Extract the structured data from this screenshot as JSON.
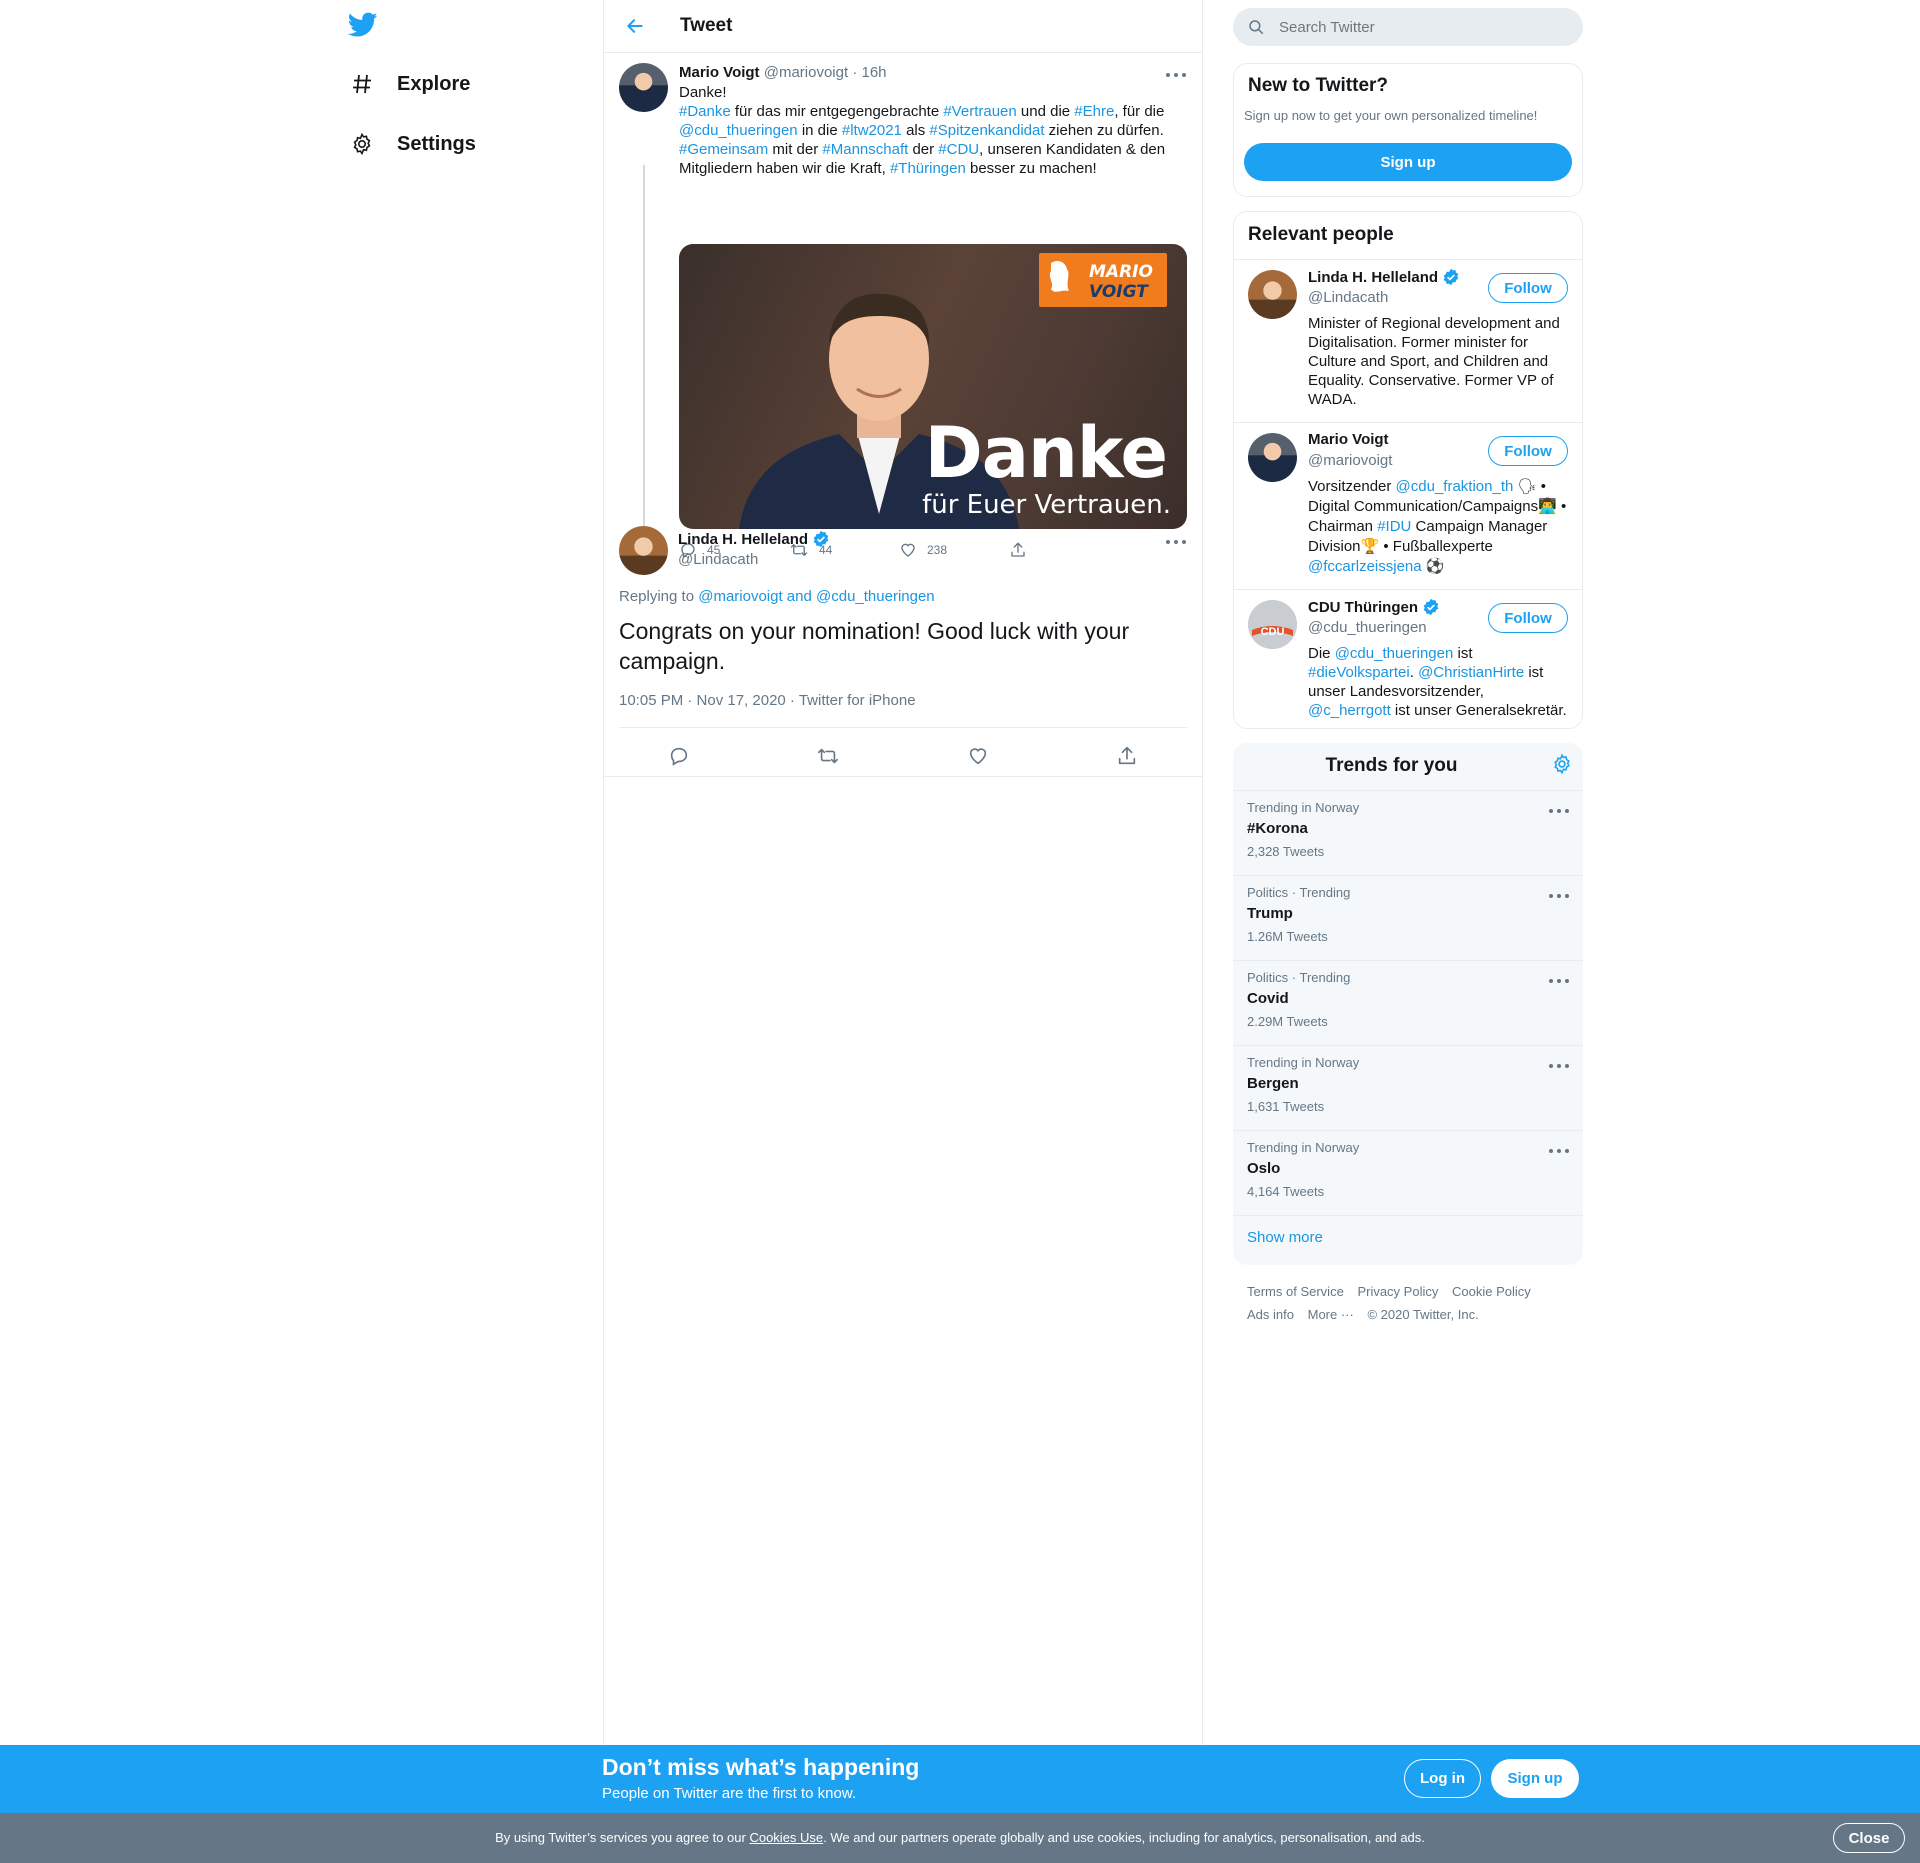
{
  "nav": {
    "logo": "twitter-bird-icon",
    "items": [
      {
        "label": "Explore",
        "icon": "hashtag-icon"
      },
      {
        "label": "Settings",
        "icon": "gear-icon"
      }
    ]
  },
  "header": {
    "title": "Tweet",
    "back_icon": "arrow-left-icon"
  },
  "parent_tweet": {
    "name": "Mario Voigt",
    "handle": "@mariovoigt",
    "time": "· 16h",
    "line1": "Danke!",
    "seg": [
      "#Danke",
      " für das mir entgegengebrachte ",
      "#Vertrauen",
      " und die ",
      "#Ehre",
      ", für die ",
      "@cdu_thueringen",
      " in die ",
      "#ltw2021",
      " als ",
      "#Spitzenkandidat",
      " ziehen zu dürfen.",
      "#Gemeinsam",
      " mit der ",
      "#Mannschaft",
      " der ",
      "#CDU",
      ", unseren Kandidaten & den Mitgliedern haben wir die Kraft, ",
      "#Thüringen",
      " besser zu machen!"
    ],
    "media": {
      "headline": "Danke",
      "subline": "für Euer Vertrauen.",
      "brand_top": "MARIO",
      "brand_bottom": "VOIGT"
    },
    "replies": "45",
    "retweets": "44",
    "likes": "238"
  },
  "main_tweet": {
    "name": "Linda H. Helleland",
    "handle": "@Lindacath",
    "replying_prefix": "Replying to",
    "replying_to": "@mariovoigt and @cdu_thueringen",
    "text": "Congrats on your nomination! Good luck with your campaign.",
    "meta": "10:05 PM · Nov 17, 2020 · Twitter for iPhone"
  },
  "search": {
    "placeholder": "Search Twitter"
  },
  "new_to_twitter": {
    "title": "New to Twitter?",
    "subtitle": "Sign up now to get your own personalized timeline!",
    "button": "Sign up"
  },
  "relevant": {
    "title": "Relevant people",
    "follow_label": "Follow",
    "people": [
      {
        "name": "Linda H. Helleland",
        "handle": "@Lindacath",
        "bio": "Minister of Regional development and Digitalisation. Former minister for Culture and Sport, and Children and Equality. Conservative. Former VP of WADA."
      },
      {
        "name": "Mario Voigt",
        "handle": "@mariovoigt",
        "bio_seg": [
          "Vorsitzender ",
          "@cdu_fraktion_th",
          " 🗣 • Digital Communication/Campaigns👨‍💻 • Chairman ",
          "#IDU",
          " Campaign Manager Division🏆 • Fußballexperte ",
          "@fccarlzeissjena",
          " ⚽"
        ]
      },
      {
        "name": "CDU Thüringen",
        "handle": "@cdu_thueringen",
        "avatar_text": "CDU",
        "bio_seg": [
          "Die ",
          "@cdu_thueringen",
          " ist ",
          "#dieVolkspartei",
          ". ",
          "@ChristianHirte",
          " ist unser Landesvorsitzender, ",
          "@c_herrgott",
          " ist unser Generalsekretär."
        ]
      }
    ]
  },
  "trends": {
    "title": "Trends for you",
    "items": [
      {
        "context": "Trending in Norway",
        "name": "#Korona",
        "count": "2,328 Tweets"
      },
      {
        "context": "Politics · Trending",
        "name": "Trump",
        "count": "1.26M Tweets"
      },
      {
        "context": "Politics · Trending",
        "name": "Covid",
        "count": "2.29M Tweets"
      },
      {
        "context": "Trending in Norway",
        "name": "Bergen",
        "count": "1,631 Tweets"
      },
      {
        "context": "Trending in Norway",
        "name": "Oslo",
        "count": "4,164 Tweets"
      }
    ],
    "show_more": "Show more"
  },
  "footer": {
    "links": [
      "Terms of Service",
      "Privacy Policy",
      "Cookie Policy",
      "Ads info",
      "More ···"
    ],
    "copyright": "© 2020 Twitter, Inc."
  },
  "banner": {
    "headline": "Don’t miss what’s happening",
    "sub": "People on Twitter are the first to know.",
    "login": "Log in",
    "signup": "Sign up"
  },
  "cookie": {
    "pre": "By using Twitter’s services you agree to our ",
    "link": "Cookies Use",
    "post": ". We and our partners operate globally and use cookies, including for analytics, personalisation, and ads.",
    "close": "Close"
  },
  "colors": {
    "accent": "#1da1f2",
    "link": "#1b95e0",
    "muted": "#657786",
    "verified": "#1da1f2",
    "cookie_bar": "#657786"
  }
}
